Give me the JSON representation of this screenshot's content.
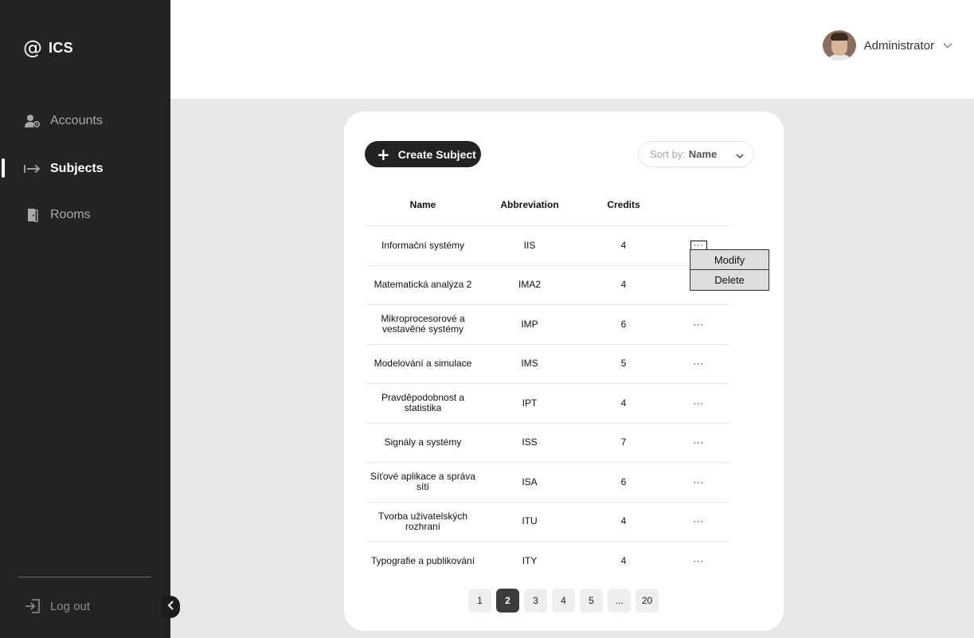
{
  "app": {
    "logo_symbol": "@",
    "logo_text": "ICS"
  },
  "sidebar": {
    "items": [
      {
        "label": "Accounts",
        "icon": "user-gear-icon",
        "active": false
      },
      {
        "label": "Subjects",
        "icon": "arrow-right-bar-icon",
        "active": true
      },
      {
        "label": "Rooms",
        "icon": "door-icon",
        "active": false
      }
    ],
    "logout_label": "Log out"
  },
  "header": {
    "user_name": "Administrator"
  },
  "toolbar": {
    "create_label": "Create Subject",
    "sort_prefix": "Sort by:",
    "sort_value": "Name"
  },
  "table": {
    "columns": [
      "Name",
      "Abbreviation",
      "Credits"
    ],
    "rows": [
      {
        "name": "Informační systémy",
        "abbr": "IIS",
        "credits": "4",
        "actions": "···"
      },
      {
        "name": "Matematická analýza 2",
        "abbr": "IMA2",
        "credits": "4",
        "actions": ""
      },
      {
        "name": "Mikroprocesorové a vestavěné systémy",
        "abbr": "IMP",
        "credits": "6",
        "actions": "···"
      },
      {
        "name": "Modelování a simulace",
        "abbr": "IMS",
        "credits": "5",
        "actions": "···"
      },
      {
        "name": "Pravděpodobnost a statistika",
        "abbr": "IPT",
        "credits": "4",
        "actions": "···"
      },
      {
        "name": "Signály a systémy",
        "abbr": "ISS",
        "credits": "7",
        "actions": "···"
      },
      {
        "name": "Síťové aplikace a správa sítí",
        "abbr": "ISA",
        "credits": "6",
        "actions": "···"
      },
      {
        "name": "Tvorba uživatelských rozhraní",
        "abbr": "ITU",
        "credits": "4",
        "actions": "···"
      },
      {
        "name": "Typografie a publikování",
        "abbr": "ITY",
        "credits": "4",
        "actions": "···"
      }
    ]
  },
  "context_menu": {
    "items": [
      "Modify",
      "Delete"
    ]
  },
  "pagination": {
    "pages": [
      "1",
      "2",
      "3",
      "4",
      "5",
      "...",
      "20"
    ],
    "current": "2"
  }
}
